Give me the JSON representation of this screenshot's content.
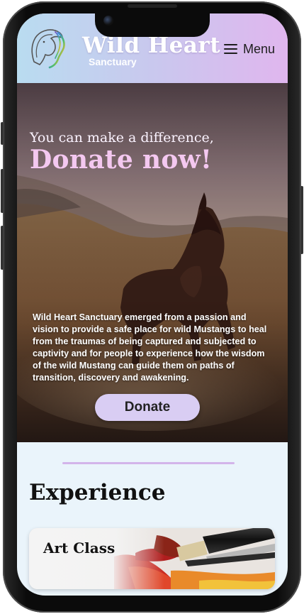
{
  "header": {
    "brand": "Wild Heart",
    "brand_sub": "Sanctuary",
    "menu_label": "Menu",
    "logo_icon": "horse-head-logo",
    "menu_icon": "hamburger-icon"
  },
  "hero": {
    "tagline": "You can make a difference,",
    "title": "Donate now!",
    "body": "Wild Heart Sanctuary emerged from a passion and vision to provide a safe place for wild Mustangs to heal from the traumas of being captured and subjected to captivity and for people to experience how the wisdom of the wild Mustang can guide them on paths of transition, discovery and awakening.",
    "donate_label": "Donate"
  },
  "experience": {
    "title": "Experience",
    "cards": [
      {
        "title": "Art Class"
      }
    ]
  },
  "colors": {
    "header_start": "#b9dcf0",
    "header_end": "#e0b6ee",
    "title_pink": "#f4c8f0",
    "button_lavender": "#d9cdf3",
    "divider": "#d3b4ea",
    "page_bg": "#eaf4fb"
  }
}
